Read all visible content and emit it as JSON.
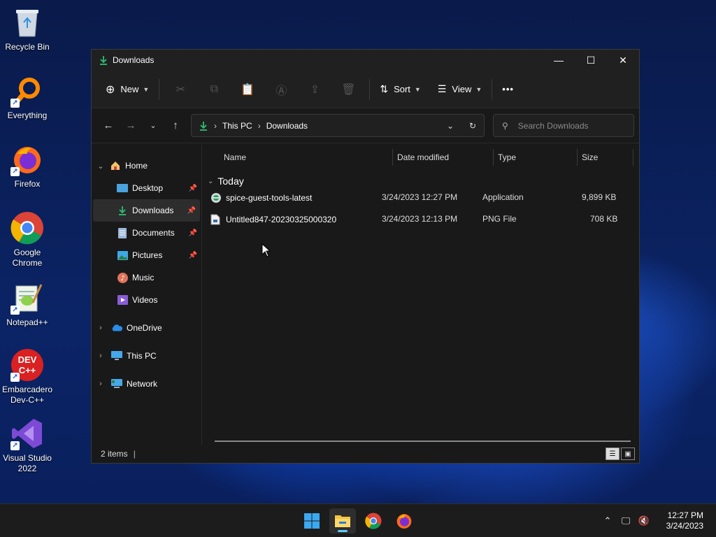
{
  "desktop": {
    "icons": [
      {
        "label": "Recycle Bin",
        "icon": "recycle-bin-icon"
      },
      {
        "label": "Everything",
        "icon": "everything-icon"
      },
      {
        "label": "Firefox",
        "icon": "firefox-icon"
      },
      {
        "label": "Google Chrome",
        "icon": "chrome-icon"
      },
      {
        "label": "Notepad++",
        "icon": "notepadpp-icon"
      },
      {
        "label": "Embarcadero Dev-C++",
        "icon": "devcpp-icon"
      },
      {
        "label": "Visual Studio 2022",
        "icon": "visual-studio-icon"
      }
    ]
  },
  "window": {
    "title": "Downloads",
    "toolbar": {
      "new_label": "New",
      "sort_label": "Sort",
      "view_label": "View",
      "more_label": "•••"
    },
    "address": {
      "segments": [
        "This PC",
        "Downloads"
      ]
    },
    "search": {
      "placeholder": "Search Downloads"
    },
    "sidebar": {
      "items": [
        {
          "label": "Home"
        },
        {
          "label": "Desktop"
        },
        {
          "label": "Downloads"
        },
        {
          "label": "Documents"
        },
        {
          "label": "Pictures"
        },
        {
          "label": "Music"
        },
        {
          "label": "Videos"
        },
        {
          "label": "OneDrive"
        },
        {
          "label": "This PC"
        },
        {
          "label": "Network"
        }
      ]
    },
    "columns": {
      "name": "Name",
      "date": "Date modified",
      "type": "Type",
      "size": "Size"
    },
    "group": "Today",
    "files": [
      {
        "name": "spice-guest-tools-latest",
        "date": "3/24/2023 12:27 PM",
        "type": "Application",
        "size": "9,899 KB"
      },
      {
        "name": "Untitled847-20230325000320",
        "date": "3/24/2023 12:13 PM",
        "type": "PNG File",
        "size": "708 KB"
      }
    ],
    "status": {
      "items": "2 items"
    }
  },
  "taskbar": {
    "time": "12:27 PM",
    "date": "3/24/2023"
  },
  "colors": {
    "accent": "#60cdff",
    "download_green": "#2fbf71"
  }
}
